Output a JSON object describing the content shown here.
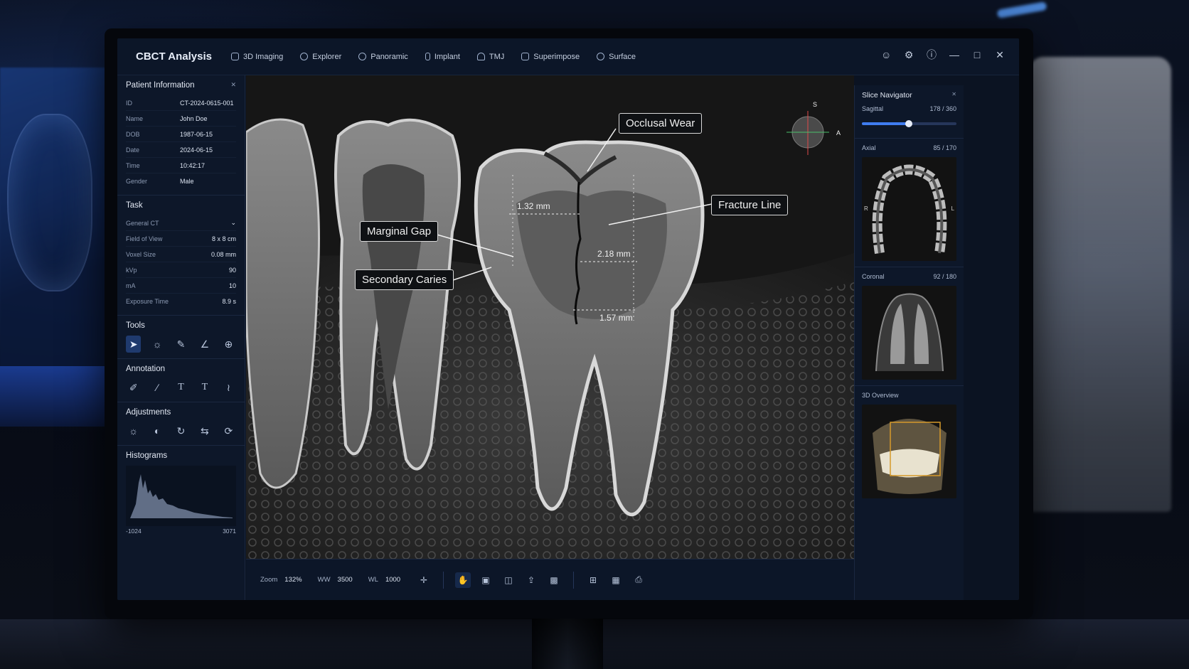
{
  "app": {
    "title": "CBCT Analysis"
  },
  "tabs": [
    {
      "label": "3D Imaging",
      "icon": "cube-icon"
    },
    {
      "label": "Explorer",
      "icon": "explorer-icon"
    },
    {
      "label": "Panoramic",
      "icon": "panoramic-icon"
    },
    {
      "label": "Implant",
      "icon": "implant-icon"
    },
    {
      "label": "TMJ",
      "icon": "tmj-icon"
    },
    {
      "label": "Superimpose",
      "icon": "superimpose-icon"
    },
    {
      "label": "Surface",
      "icon": "surface-icon"
    }
  ],
  "patient": {
    "title": "Patient Information",
    "fields": [
      {
        "k": "ID",
        "v": "CT-2024-0615-001"
      },
      {
        "k": "Name",
        "v": "John Doe"
      },
      {
        "k": "DOB",
        "v": "1987-06-15"
      },
      {
        "k": "Date",
        "v": "2024-06-15"
      },
      {
        "k": "Time",
        "v": "10:42:17"
      },
      {
        "k": "Gender",
        "v": "Male"
      }
    ]
  },
  "task": {
    "title": "Task",
    "selected": "General CT",
    "fields": [
      {
        "k": "Field of View",
        "v": "8 x 8 cm"
      },
      {
        "k": "Voxel Size",
        "v": "0.08 mm"
      },
      {
        "k": "kVp",
        "v": "90"
      },
      {
        "k": "mA",
        "v": "10"
      },
      {
        "k": "Exposure Time",
        "v": "8.9 s"
      }
    ]
  },
  "sections": {
    "tools": "Tools",
    "annotation": "Annotation",
    "adjustments": "Adjustments",
    "histograms": "Histograms"
  },
  "histogram": {
    "min": "-1024",
    "max": "3071"
  },
  "viewer": {
    "labels": {
      "occlusal": "Occlusal Wear",
      "fracture": "Fracture Line",
      "marginal": "Marginal Gap",
      "caries": "Secondary Caries"
    },
    "measurements": {
      "m1": "1.32 mm",
      "m2": "2.18 mm",
      "m3": "1.57 mm"
    },
    "orientation": {
      "s": "S",
      "a": "A"
    }
  },
  "bottombar": {
    "zoom_label": "Zoom",
    "zoom_value": "132%",
    "ww_label": "WW",
    "ww_value": "3500",
    "wl_label": "WL",
    "wl_value": "1000"
  },
  "right": {
    "slice_title": "Slice Navigator",
    "sagittal": {
      "label": "Sagittal",
      "value": "178 / 360",
      "fraction": 0.494
    },
    "axial": {
      "label": "Axial",
      "value": "85 / 170",
      "left": "R",
      "right": "L"
    },
    "coronal": {
      "label": "Coronal",
      "value": "92 / 180"
    },
    "overview": {
      "label": "3D Overview"
    }
  },
  "colors": {
    "accent": "#3f7cf0",
    "panel": "#0d1729",
    "label_border": "#d9d9d9"
  }
}
